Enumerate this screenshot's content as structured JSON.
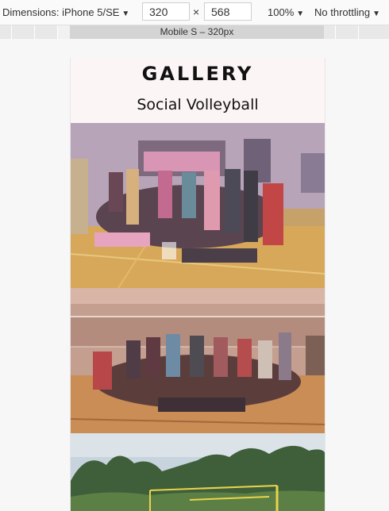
{
  "devtools": {
    "device_label": "Dimensions: iPhone 5/SE",
    "width": "320",
    "times": "×",
    "height": "568",
    "zoom": "100%",
    "throttle": "No throttling",
    "media_query_label": "Mobile S – 320px"
  },
  "page": {
    "title": "GALLERY",
    "subtitle": "Social Volleyball"
  },
  "photos": [
    {
      "icon": "group-photo-hall-1"
    },
    {
      "icon": "group-photo-hall-2"
    },
    {
      "icon": "outdoor-volleyball-photo"
    }
  ]
}
